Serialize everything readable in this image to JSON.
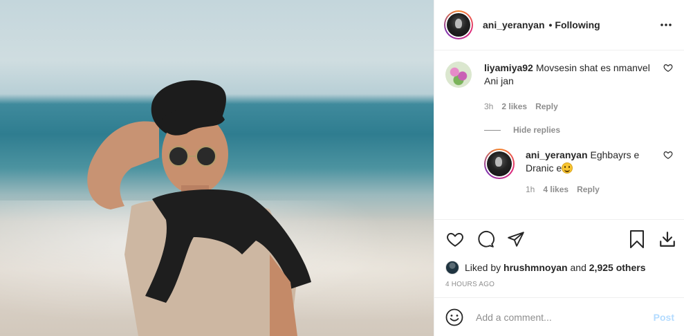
{
  "header": {
    "username": "ani_yeranyan",
    "separator": "•",
    "follow_status": "Following",
    "more_icon": "more-horizontal-icon"
  },
  "comments": [
    {
      "username": "liyamiya92",
      "text": "Movsesin shat es nmanvel Ani jan",
      "time": "3h",
      "likes": "2 likes",
      "reply_label": "Reply"
    }
  ],
  "hide_replies_label": "Hide replies",
  "reply": {
    "username": "ani_yeranyan",
    "text": "Eghbayrs e Dranic e",
    "time": "1h",
    "likes": "4 likes",
    "reply_label": "Reply"
  },
  "actions": {
    "like_icon": "heart-icon",
    "comment_icon": "comment-icon",
    "share_icon": "paper-plane-icon",
    "save_icon": "bookmark-icon",
    "download_icon": "download-icon"
  },
  "likes": {
    "prefix": "Liked by",
    "user": "hrushmnoyan",
    "and": "and",
    "others": "2,925 others"
  },
  "timestamp": "4 HOURS AGO",
  "add_comment": {
    "placeholder": "Add a comment...",
    "post_label": "Post"
  },
  "colors": {
    "post_disabled": "#b3dbff",
    "muted": "#8e8e8e",
    "text": "#262626"
  }
}
